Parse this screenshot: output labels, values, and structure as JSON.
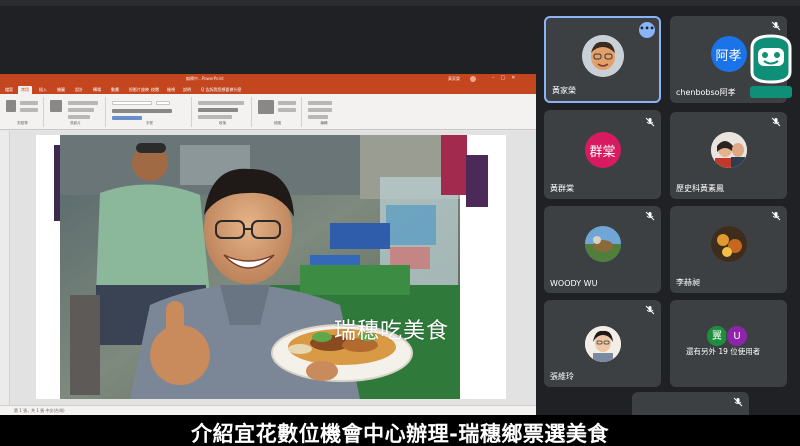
{
  "ppt": {
    "window_title": "編輯中...PowerPoint",
    "user_name": "黃家榮",
    "tabs": [
      "檔案",
      "常用",
      "插入",
      "繪圖",
      "設計",
      "轉場",
      "動畫",
      "投影片放映",
      "校閱",
      "檢視",
      "說明",
      "Q 告訴我您想要做什麼"
    ],
    "ribbon_groups": [
      "剪貼簿",
      "投影片",
      "字型",
      "段落",
      "繪圖",
      "編輯"
    ],
    "status_text": "第 1 張，共 1 張 中文(台灣)",
    "slide_caption": "瑞穗吃美食"
  },
  "participants": [
    {
      "name": "黃家榮",
      "avatar_type": "cartoon",
      "active": true,
      "muted": false
    },
    {
      "name": "chenbobso阿孝",
      "avatar_text": "阿孝",
      "avatar_color": "#1a73e8",
      "muted": true
    },
    {
      "name": "",
      "avatar_text": "",
      "muted": true
    },
    {
      "name": "黃群棠",
      "avatar_text": "群棠",
      "avatar_color": "#d81b60",
      "muted": true
    },
    {
      "name": "歷史科黃素鳳",
      "avatar_type": "photo",
      "muted": true
    },
    {
      "name": "WOODY WU",
      "avatar_type": "photo",
      "muted": true
    },
    {
      "name": "李赫昶",
      "avatar_type": "photo",
      "muted": true
    },
    {
      "name": "張維玲",
      "avatar_type": "photo",
      "muted": true
    },
    {
      "name": "還有另外 19 位使用者",
      "avatar_letters": [
        "翼",
        "U"
      ],
      "avatar_colors": [
        "#1e8e3e",
        "#8e24aa"
      ]
    }
  ],
  "subtitle": "介紹宜花數位機會中心辦理-瑞穗鄉票選美食",
  "colors": {
    "ppt_accent": "#c4461f",
    "tile_bg": "#3c4043",
    "active_border": "#8ab4f8",
    "stage_bg": "#202124"
  }
}
